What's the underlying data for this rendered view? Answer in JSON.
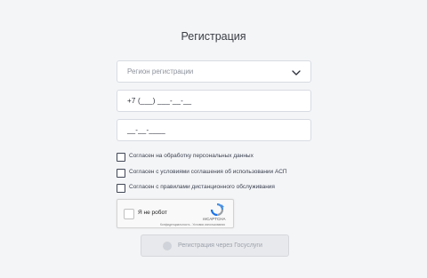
{
  "form": {
    "title": "Регистрация",
    "region": {
      "placeholder": "Регион регистрации"
    },
    "phone": {
      "value": "+7 (___) ___-__-__"
    },
    "code": {
      "value": "__-__-____"
    }
  },
  "agreements": [
    {
      "label": "Согласен на обработку персональных данных",
      "checked": false
    },
    {
      "label": "Согласен с условиями соглашения об использовании АСП",
      "checked": false
    },
    {
      "label": "Согласен с правилами дистанционного обслуживания",
      "checked": false
    }
  ],
  "captcha": {
    "label": "Я не робот",
    "brand": "reCAPTCHA",
    "terms": "Конфиденциальность - Условия использования",
    "logo_icon": "recaptcha-logo-icon"
  },
  "submit": {
    "label": "Регистрация через Госуслуги",
    "icon": "gosuslugi-icon",
    "enabled": false
  },
  "colors": {
    "background": "#f4f5f7",
    "field_border": "#d7dbe2",
    "checkbox_border": "#3f4655",
    "button_disabled": "#e8e9ec"
  }
}
